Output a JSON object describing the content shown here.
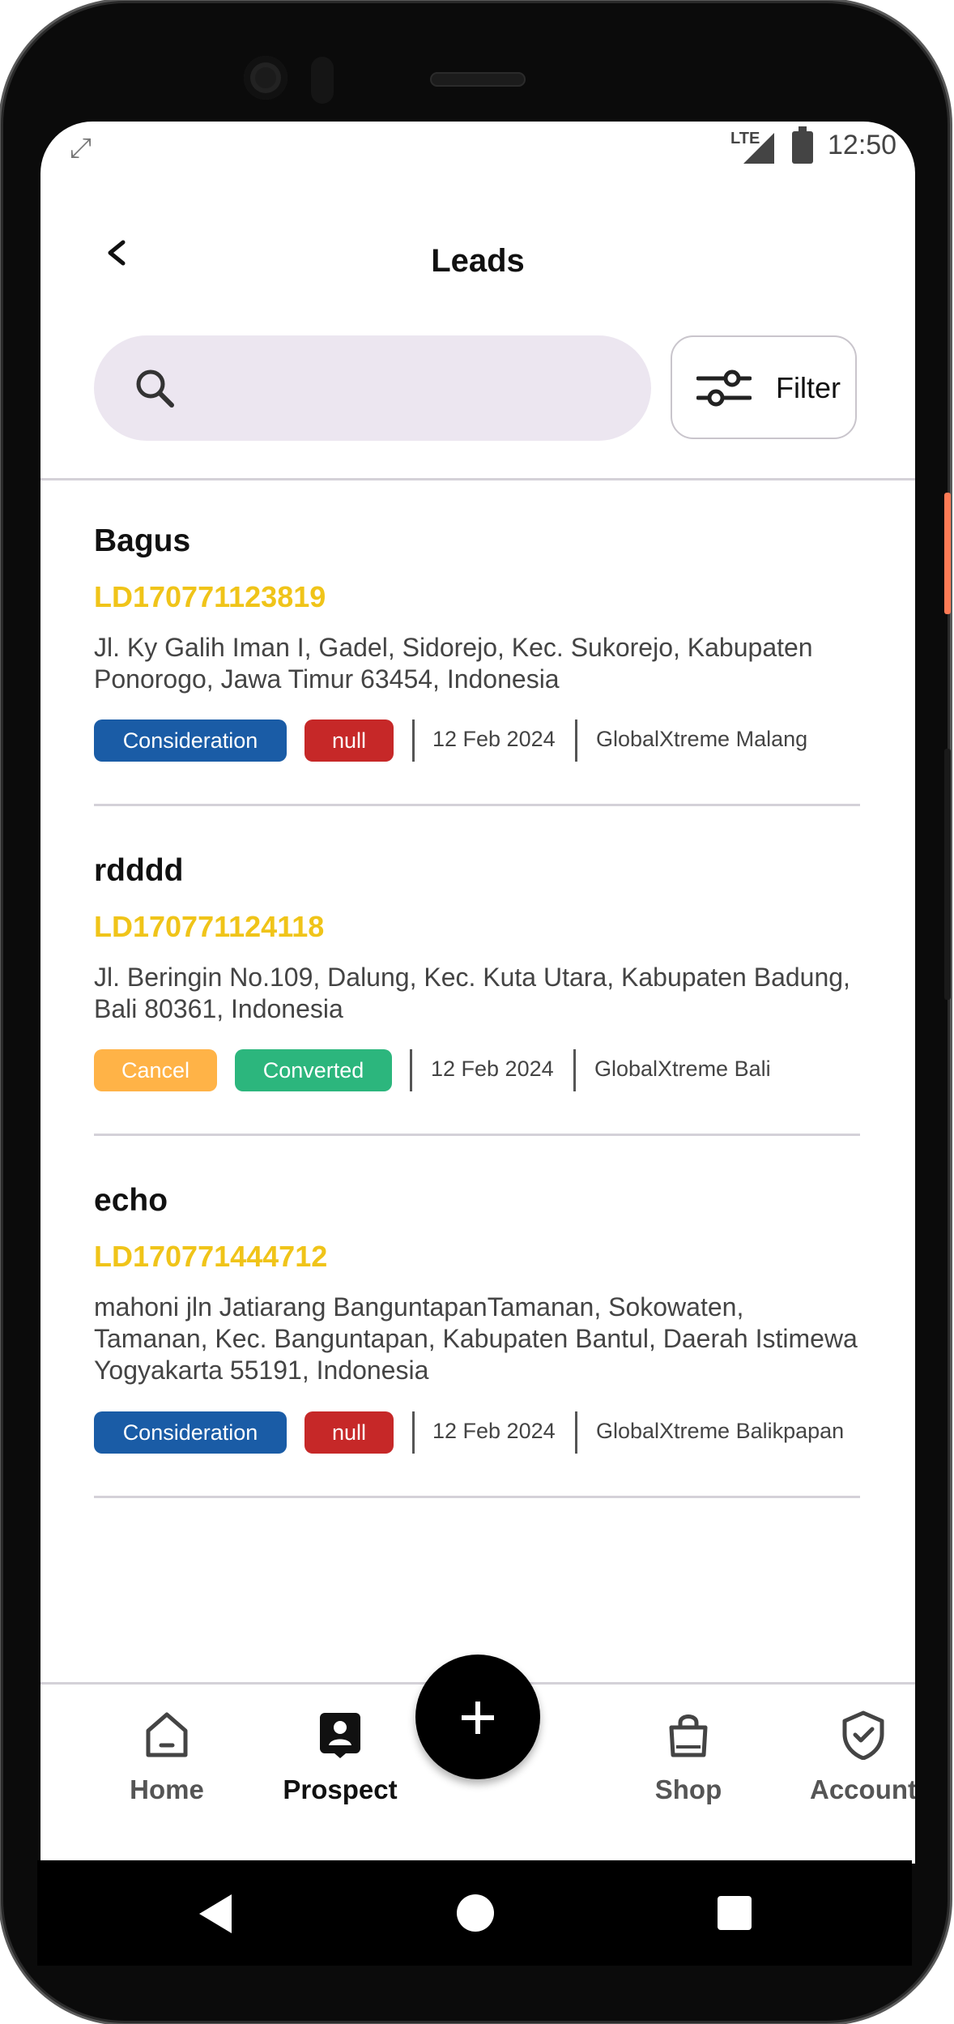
{
  "status_bar": {
    "network": "LTE",
    "time": "12:50"
  },
  "header": {
    "title": "Leads",
    "search_placeholder": "",
    "filter_label": "Filter"
  },
  "leads": [
    {
      "name": "Bagus",
      "code": "LD170771123819",
      "address": "Jl. Ky Galih Iman I, Gadel, Sidorejo, Kec. Sukorejo, Kabupaten Ponorogo, Jawa Timur 63454, Indonesia",
      "status": "Consideration",
      "status_color": "#1a5ca6",
      "sub_status": "null",
      "sub_status_color": "#c62828",
      "date": "12 Feb 2024",
      "branch": "GlobalXtreme Malang"
    },
    {
      "name": "rdddd",
      "code": "LD170771124118",
      "address": "Jl. Beringin No.109, Dalung, Kec. Kuta Utara, Kabupaten Badung, Bali 80361, Indonesia",
      "status": "Cancel",
      "status_color": "#ffb347",
      "sub_status": "Converted",
      "sub_status_color": "#2cb67d",
      "date": "12 Feb 2024",
      "branch": "GlobalXtreme Bali"
    },
    {
      "name": "echo",
      "code": "LD170771444712",
      "address": "mahoni jln Jatiarang BanguntapanTamanan, Sokowaten, Tamanan, Kec. Banguntapan, Kabupaten Bantul, Daerah Istimewa Yogyakarta 55191, Indonesia",
      "status": "Consideration",
      "status_color": "#1a5ca6",
      "sub_status": "null",
      "sub_status_color": "#c62828",
      "date": "12 Feb 2024",
      "branch": "GlobalXtreme Balikpapan"
    }
  ],
  "bottom_nav": {
    "items": [
      {
        "label": "Home",
        "icon": "home-icon",
        "active": false
      },
      {
        "label": "Prospect",
        "icon": "prospect-icon",
        "active": true
      },
      {
        "label": "Shop",
        "icon": "shopping-bag-icon",
        "active": false
      },
      {
        "label": "Account",
        "icon": "account-shield-icon",
        "active": false
      }
    ],
    "fab_icon": "plus-icon"
  },
  "colors": {
    "accent_code": "#f0c419",
    "search_bg": "#ece6f0"
  }
}
